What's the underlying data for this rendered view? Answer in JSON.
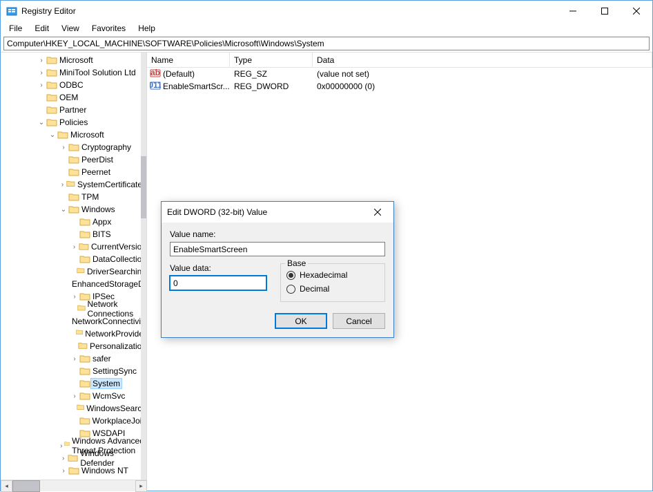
{
  "window": {
    "title": "Registry Editor"
  },
  "menu": {
    "file": "File",
    "edit": "Edit",
    "view": "View",
    "favorites": "Favorites",
    "help": "Help"
  },
  "address": "Computer\\HKEY_LOCAL_MACHINE\\SOFTWARE\\Policies\\Microsoft\\Windows\\System",
  "tree": {
    "top": [
      {
        "label": "Microsoft",
        "expandable": true
      },
      {
        "label": "MiniTool Solution Ltd",
        "expandable": true
      },
      {
        "label": "ODBC",
        "expandable": true
      },
      {
        "label": "OEM",
        "expandable": false
      },
      {
        "label": "Partner",
        "expandable": false
      }
    ],
    "policies": "Policies",
    "microsoft": "Microsoft",
    "ms_children": [
      {
        "label": "Cryptography",
        "expandable": true,
        "indent": 0
      },
      {
        "label": "PeerDist",
        "expandable": false,
        "indent": 0
      },
      {
        "label": "Peernet",
        "expandable": false,
        "indent": 0
      },
      {
        "label": "SystemCertificates",
        "expandable": true,
        "indent": 0
      },
      {
        "label": "TPM",
        "expandable": false,
        "indent": 0
      }
    ],
    "windows": "Windows",
    "win_children": [
      {
        "label": "Appx",
        "expandable": false
      },
      {
        "label": "BITS",
        "expandable": false
      },
      {
        "label": "CurrentVersion",
        "expandable": true
      },
      {
        "label": "DataCollection",
        "expandable": false
      },
      {
        "label": "DriverSearching",
        "expandable": false
      },
      {
        "label": "EnhancedStorageDevices",
        "expandable": false
      },
      {
        "label": "IPSec",
        "expandable": true
      },
      {
        "label": "Network Connections",
        "expandable": false
      },
      {
        "label": "NetworkConnectivityStatusIndicator",
        "expandable": false
      },
      {
        "label": "NetworkProvider",
        "expandable": false
      },
      {
        "label": "Personalization",
        "expandable": false
      },
      {
        "label": "safer",
        "expandable": true
      },
      {
        "label": "SettingSync",
        "expandable": false
      },
      {
        "label": "System",
        "expandable": false,
        "selected": true
      },
      {
        "label": "WcmSvc",
        "expandable": true
      },
      {
        "label": "WindowsSearch",
        "expandable": false
      },
      {
        "label": "WorkplaceJoin",
        "expandable": false
      },
      {
        "label": "WSDAPI",
        "expandable": false
      }
    ],
    "after": [
      {
        "label": "Windows Advanced Threat Protection",
        "expandable": true
      },
      {
        "label": "Windows Defender",
        "expandable": true
      },
      {
        "label": "Windows NT",
        "expandable": true
      }
    ]
  },
  "values": {
    "headers": {
      "name": "Name",
      "type": "Type",
      "data": "Data"
    },
    "rows": [
      {
        "icon": "sz",
        "name": "(Default)",
        "type": "REG_SZ",
        "data": "(value not set)"
      },
      {
        "icon": "dw",
        "name": "EnableSmartScr...",
        "type": "REG_DWORD",
        "data": "0x00000000 (0)"
      }
    ]
  },
  "dialog": {
    "title": "Edit DWORD (32-bit) Value",
    "name_label": "Value name:",
    "name_value": "EnableSmartScreen",
    "data_label": "Value data:",
    "data_value": "0",
    "base_label": "Base",
    "hex": "Hexadecimal",
    "dec": "Decimal",
    "ok": "OK",
    "cancel": "Cancel"
  }
}
